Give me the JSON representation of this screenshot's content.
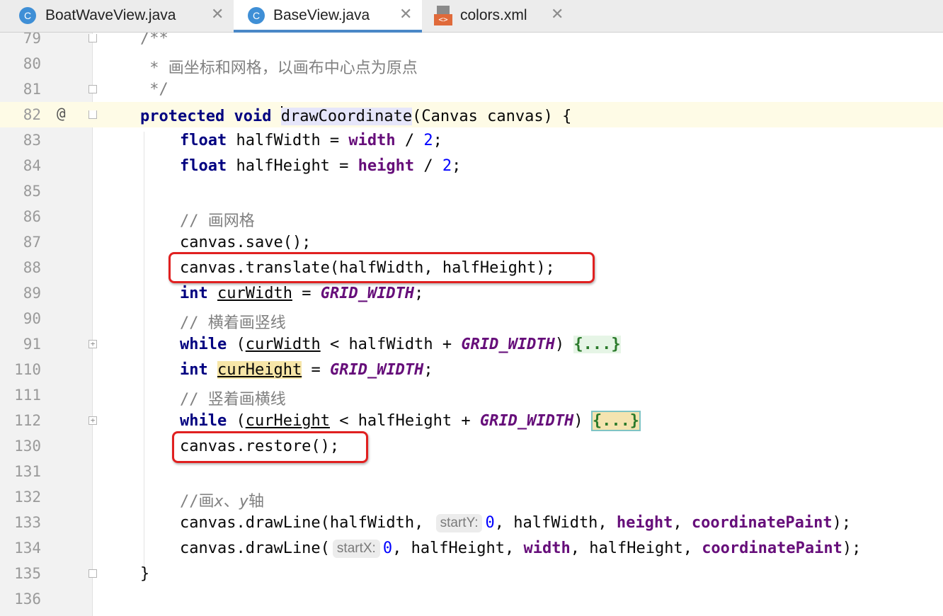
{
  "tabs": [
    {
      "icon": "C",
      "label": "BoatWaveView.java",
      "active": false
    },
    {
      "icon": "C",
      "label": "BaseView.java",
      "active": true
    },
    {
      "icon": "<>",
      "label": "colors.xml",
      "active": false
    }
  ],
  "close_glyph": "✕",
  "gutter": {
    "line_numbers": [
      "79",
      "80",
      "81",
      "82",
      "83",
      "84",
      "85",
      "86",
      "87",
      "88",
      "89",
      "90",
      "91",
      "110",
      "111",
      "112",
      "130",
      "131",
      "132",
      "133",
      "134",
      "135",
      "136"
    ],
    "override_marker": "@"
  },
  "code": {
    "l79": "/**",
    "l80": " * 画坐标和网格，以画布中心点为原点",
    "l81": " */",
    "l82_kw1": "protected",
    "l82_kw2": "void",
    "l82_method": "drawCoordinate",
    "l82_rest": "(Canvas canvas) {",
    "l83_kw": "float",
    "l83_a": " halfWidth = ",
    "l83_field": "width",
    "l83_b": " / ",
    "l83_num": "2",
    "l83_c": ";",
    "l84_kw": "float",
    "l84_a": " halfHeight = ",
    "l84_field": "height",
    "l84_b": " / ",
    "l84_num": "2",
    "l84_c": ";",
    "l86": "// 画网格",
    "l87": "canvas.save();",
    "l88": "canvas.translate(halfWidth, halfHeight);",
    "l89_kw": "int",
    "l89_var": "curWidth",
    "l89_a": " = ",
    "l89_const": "GRID_WIDTH",
    "l89_b": ";",
    "l90": "// 横着画竖线",
    "l91_kw": "while",
    "l91_a": " (",
    "l91_var": "curWidth",
    "l91_b": " < halfWidth + ",
    "l91_const": "GRID_WIDTH",
    "l91_c": ") ",
    "l91_fold": "{...}",
    "l110_kw": "int",
    "l110_var": "curHeight",
    "l110_a": " = ",
    "l110_const": "GRID_WIDTH",
    "l110_b": ";",
    "l111": "// 竖着画横线",
    "l112_kw": "while",
    "l112_a": " (",
    "l112_var": "curHeight",
    "l112_b": " < halfHeight + ",
    "l112_const": "GRID_WIDTH",
    "l112_c": ") ",
    "l112_fold": "{...}",
    "l130": "canvas.restore();",
    "l132_a": "//画",
    "l132_x": "x",
    "l132_b": "、",
    "l132_y": "y",
    "l132_c": "轴",
    "l133_a": "canvas.drawLine(halfWidth, ",
    "l133_hint": "startY:",
    "l133_num": "0",
    "l133_b": ", halfWidth, ",
    "l133_field1": "height",
    "l133_c": ", ",
    "l133_field2": "coordinatePaint",
    "l133_d": ");",
    "l134_a": "canvas.drawLine(",
    "l134_hint": "startX:",
    "l134_num": "0",
    "l134_b": ", halfHeight, ",
    "l134_field1": "width",
    "l134_c": ", halfHeight, ",
    "l134_field2": "coordinatePaint",
    "l134_d": ");",
    "l135": "}"
  }
}
